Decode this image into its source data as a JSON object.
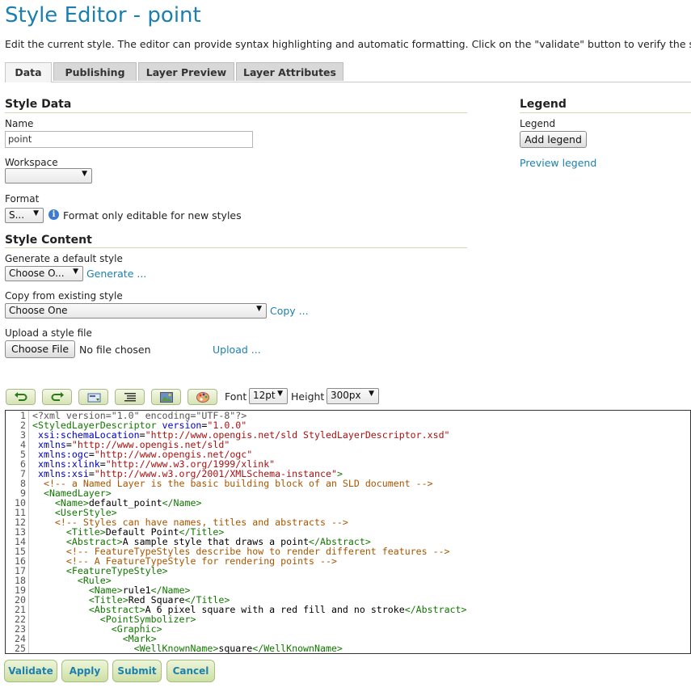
{
  "page": {
    "title": "Style Editor - point",
    "description": "Edit the current style. The editor can provide syntax highlighting and automatic formatting. Click on the \"validate\" button to verify the style"
  },
  "tabs": [
    {
      "label": "Data",
      "active": true
    },
    {
      "label": "Publishing",
      "active": false
    },
    {
      "label": "Layer Preview",
      "active": false
    },
    {
      "label": "Layer Attributes",
      "active": false
    }
  ],
  "style_data": {
    "heading": "Style Data",
    "name_label": "Name",
    "name_value": "point",
    "workspace_label": "Workspace",
    "workspace_value": "",
    "format_label": "Format",
    "format_value": "S...",
    "format_note": "Format only editable for new styles"
  },
  "legend": {
    "heading": "Legend",
    "label": "Legend",
    "add_button": "Add legend",
    "preview_link": "Preview legend"
  },
  "style_content": {
    "heading": "Style Content",
    "generate_label": "Generate a default style",
    "generate_select": "Choose O...",
    "generate_link": "Generate ...",
    "copy_label": "Copy from existing style",
    "copy_select": "Choose One",
    "copy_link": "Copy ...",
    "upload_label": "Upload a style file",
    "choose_file_button": "Choose File",
    "no_file_text": "No file chosen",
    "upload_link": "Upload ..."
  },
  "toolbar": {
    "buttons": [
      "undo-icon",
      "redo-icon",
      "search-replace-icon",
      "reindent-icon",
      "image-icon",
      "palette-icon"
    ],
    "font_label": "Font",
    "font_value": "12pt",
    "height_label": "Height",
    "height_value": "300px"
  },
  "editor": {
    "line_numbers": [
      "1",
      "2",
      "3",
      "4",
      "5",
      "6",
      "7",
      "8",
      "9",
      "10",
      "11",
      "12",
      "13",
      "14",
      "15",
      "16",
      "17",
      "18",
      "19",
      "20",
      "21",
      "22",
      "23",
      "24",
      "25"
    ],
    "lines": [
      [
        [
          "pi",
          "<?xml version=\"1.0\" encoding=\"UTF-8\"?>"
        ]
      ],
      [
        [
          "tag",
          "<StyledLayerDescriptor"
        ],
        [
          "txt",
          " "
        ],
        [
          "attr",
          "version"
        ],
        [
          "txt",
          "="
        ],
        [
          "val",
          "\"1.0.0\""
        ]
      ],
      [
        [
          "txt",
          " "
        ],
        [
          "attr",
          "xsi:schemaLocation"
        ],
        [
          "txt",
          "="
        ],
        [
          "val",
          "\"http://www.opengis.net/sld StyledLayerDescriptor.xsd\""
        ]
      ],
      [
        [
          "txt",
          " "
        ],
        [
          "attr",
          "xmlns"
        ],
        [
          "txt",
          "="
        ],
        [
          "val",
          "\"http://www.opengis.net/sld\""
        ]
      ],
      [
        [
          "txt",
          " "
        ],
        [
          "attr",
          "xmlns:ogc"
        ],
        [
          "txt",
          "="
        ],
        [
          "val",
          "\"http://www.opengis.net/ogc\""
        ]
      ],
      [
        [
          "txt",
          " "
        ],
        [
          "attr",
          "xmlns:xlink"
        ],
        [
          "txt",
          "="
        ],
        [
          "val",
          "\"http://www.w3.org/1999/xlink\""
        ]
      ],
      [
        [
          "txt",
          " "
        ],
        [
          "attr",
          "xmlns:xsi"
        ],
        [
          "txt",
          "="
        ],
        [
          "val",
          "\"http://www.w3.org/2001/XMLSchema-instance\""
        ],
        [
          "tag",
          ">"
        ]
      ],
      [
        [
          "txt",
          "  "
        ],
        [
          "com",
          "<!-- a Named Layer is the basic building block of an SLD document -->"
        ]
      ],
      [
        [
          "txt",
          "  "
        ],
        [
          "tag",
          "<NamedLayer>"
        ]
      ],
      [
        [
          "txt",
          "    "
        ],
        [
          "tag",
          "<Name>"
        ],
        [
          "txt",
          "default_point"
        ],
        [
          "tag",
          "</Name>"
        ]
      ],
      [
        [
          "txt",
          "    "
        ],
        [
          "tag",
          "<UserStyle>"
        ]
      ],
      [
        [
          "txt",
          "    "
        ],
        [
          "com",
          "<!-- Styles can have names, titles and abstracts -->"
        ]
      ],
      [
        [
          "txt",
          "      "
        ],
        [
          "tag",
          "<Title>"
        ],
        [
          "txt",
          "Default Point"
        ],
        [
          "tag",
          "</Title>"
        ]
      ],
      [
        [
          "txt",
          "      "
        ],
        [
          "tag",
          "<Abstract>"
        ],
        [
          "txt",
          "A sample style that draws a point"
        ],
        [
          "tag",
          "</Abstract>"
        ]
      ],
      [
        [
          "txt",
          "      "
        ],
        [
          "com",
          "<!-- FeatureTypeStyles describe how to render different features -->"
        ]
      ],
      [
        [
          "txt",
          "      "
        ],
        [
          "com",
          "<!-- A FeatureTypeStyle for rendering points -->"
        ]
      ],
      [
        [
          "txt",
          "      "
        ],
        [
          "tag",
          "<FeatureTypeStyle>"
        ]
      ],
      [
        [
          "txt",
          "        "
        ],
        [
          "tag",
          "<Rule>"
        ]
      ],
      [
        [
          "txt",
          "          "
        ],
        [
          "tag",
          "<Name>"
        ],
        [
          "txt",
          "rule1"
        ],
        [
          "tag",
          "</Name>"
        ]
      ],
      [
        [
          "txt",
          "          "
        ],
        [
          "tag",
          "<Title>"
        ],
        [
          "txt",
          "Red Square"
        ],
        [
          "tag",
          "</Title>"
        ]
      ],
      [
        [
          "txt",
          "          "
        ],
        [
          "tag",
          "<Abstract>"
        ],
        [
          "txt",
          "A 6 pixel square with a red fill and no stroke"
        ],
        [
          "tag",
          "</Abstract>"
        ]
      ],
      [
        [
          "txt",
          "            "
        ],
        [
          "tag",
          "<PointSymbolizer>"
        ]
      ],
      [
        [
          "txt",
          "              "
        ],
        [
          "tag",
          "<Graphic>"
        ]
      ],
      [
        [
          "txt",
          "                "
        ],
        [
          "tag",
          "<Mark>"
        ]
      ],
      [
        [
          "txt",
          "                  "
        ],
        [
          "tag",
          "<WellKnownName>"
        ],
        [
          "txt",
          "square"
        ],
        [
          "tag",
          "</WellKnownName>"
        ]
      ]
    ]
  },
  "actions": [
    "Validate",
    "Apply",
    "Submit",
    "Cancel"
  ]
}
